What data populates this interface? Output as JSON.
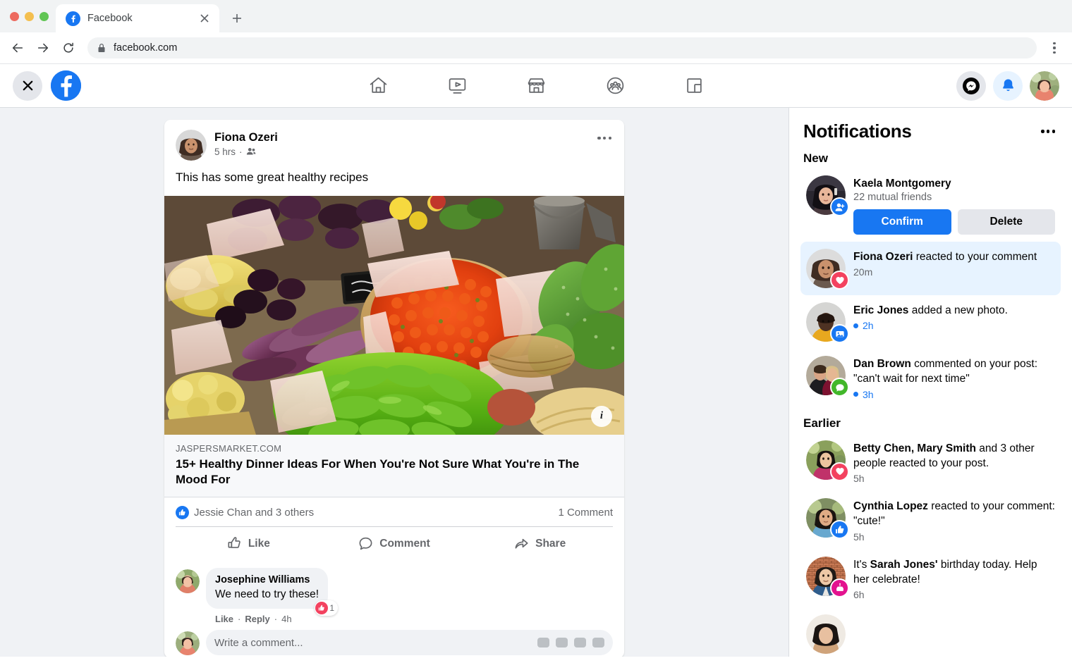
{
  "browser": {
    "tab_title": "Facebook",
    "url": "facebook.com",
    "icons": {
      "favicon": "facebook-favicon",
      "close": "tab-close-icon",
      "newtab": "new-tab-icon",
      "back": "back-icon",
      "forward": "forward-icon",
      "reload": "reload-icon",
      "lock": "lock-icon",
      "menu": "browser-menu-icon"
    }
  },
  "fbnav": {
    "close_label": "close-overlay",
    "logo_label": "facebook-logo",
    "tabs": [
      {
        "name": "home",
        "label": "Home"
      },
      {
        "name": "watch",
        "label": "Watch"
      },
      {
        "name": "marketplace",
        "label": "Marketplace"
      },
      {
        "name": "groups",
        "label": "Groups"
      },
      {
        "name": "gaming",
        "label": "Gaming"
      }
    ],
    "messenger_label": "Messenger",
    "notifications_label": "Notifications",
    "account_label": "Account"
  },
  "post": {
    "author": "Fiona Ozeri",
    "time": "5 hrs",
    "privacy_icon": "friends-icon",
    "menu_icon": "post-menu-icon",
    "text": "This has some great healthy recipes",
    "image_alt": "farmers market produce stand",
    "info_button": "i",
    "link_domain": "JASPERSMARKET.COM",
    "link_title": "15+ Healthy Dinner Ideas For When You're Not Sure What You're in The Mood For",
    "reactions_text": "Jessie Chan and 3 others",
    "comment_count": "1 Comment",
    "actions": [
      {
        "name": "like",
        "label": "Like"
      },
      {
        "name": "comment",
        "label": "Comment"
      },
      {
        "name": "share",
        "label": "Share"
      }
    ],
    "comments": [
      {
        "author": "Josephine Williams",
        "text": "We need to try these!",
        "reaction_count": "1",
        "reaction_type": "like",
        "like_label": "Like",
        "reply_label": "Reply",
        "time": "4h"
      }
    ],
    "comment_placeholder": "Write a comment..."
  },
  "notifications": {
    "title": "Notifications",
    "menu_icon": "notifications-menu-icon",
    "sections": [
      {
        "label": "New",
        "items": [
          {
            "type": "friend-request",
            "name": "Kaela Montgomery",
            "sub": "22 mutual friends",
            "badge": "friend-request-icon",
            "badge_color": "#1877f2",
            "confirm_label": "Confirm",
            "delete_label": "Delete",
            "unread": false
          },
          {
            "type": "reaction",
            "name": "Fiona Ozeri",
            "rest": " reacted to your comment",
            "time": "20m",
            "badge": "heart-icon",
            "badge_color": "#f3425f",
            "unread": true,
            "time_blue": false
          },
          {
            "type": "photo",
            "name": "Eric Jones",
            "rest": " added a new photo.",
            "time": "2h",
            "badge": "photo-icon",
            "badge_color": "#1877f2",
            "unread": false,
            "time_blue": true
          },
          {
            "type": "comment",
            "name": "Dan Brown",
            "rest": " commented on your post: \"can't wait for next time\"",
            "time": "3h",
            "badge": "comment-icon",
            "badge_color": "#42b72a",
            "unread": false,
            "time_blue": true
          }
        ]
      },
      {
        "label": "Earlier",
        "items": [
          {
            "type": "reaction",
            "name": "Betty Chen, Mary Smith",
            "rest": " and 3 other people reacted to your post.",
            "time": "5h",
            "badge": "heart-icon",
            "badge_color": "#f3425f",
            "unread": false,
            "time_blue": false
          },
          {
            "type": "reaction",
            "name": "Cynthia Lopez",
            "rest": " reacted to your comment: \"cute!\"",
            "time": "5h",
            "badge": "like-icon",
            "badge_color": "#1877f2",
            "unread": false,
            "time_blue": false
          },
          {
            "type": "birthday",
            "pre": "It's ",
            "name": "Sarah Jones'",
            "rest": " birthday today. Help her celebrate!",
            "time": "6h",
            "badge": "birthday-cake-icon",
            "badge_color": "#e3138f",
            "unread": false,
            "time_blue": false
          }
        ]
      }
    ]
  },
  "colors": {
    "fb_blue": "#1877f2",
    "unread_bg": "#e7f3ff",
    "page_bg": "#f0f2f5",
    "heart_red": "#f3425f",
    "comment_green": "#42b72a",
    "birthday_pink": "#e3138f"
  }
}
